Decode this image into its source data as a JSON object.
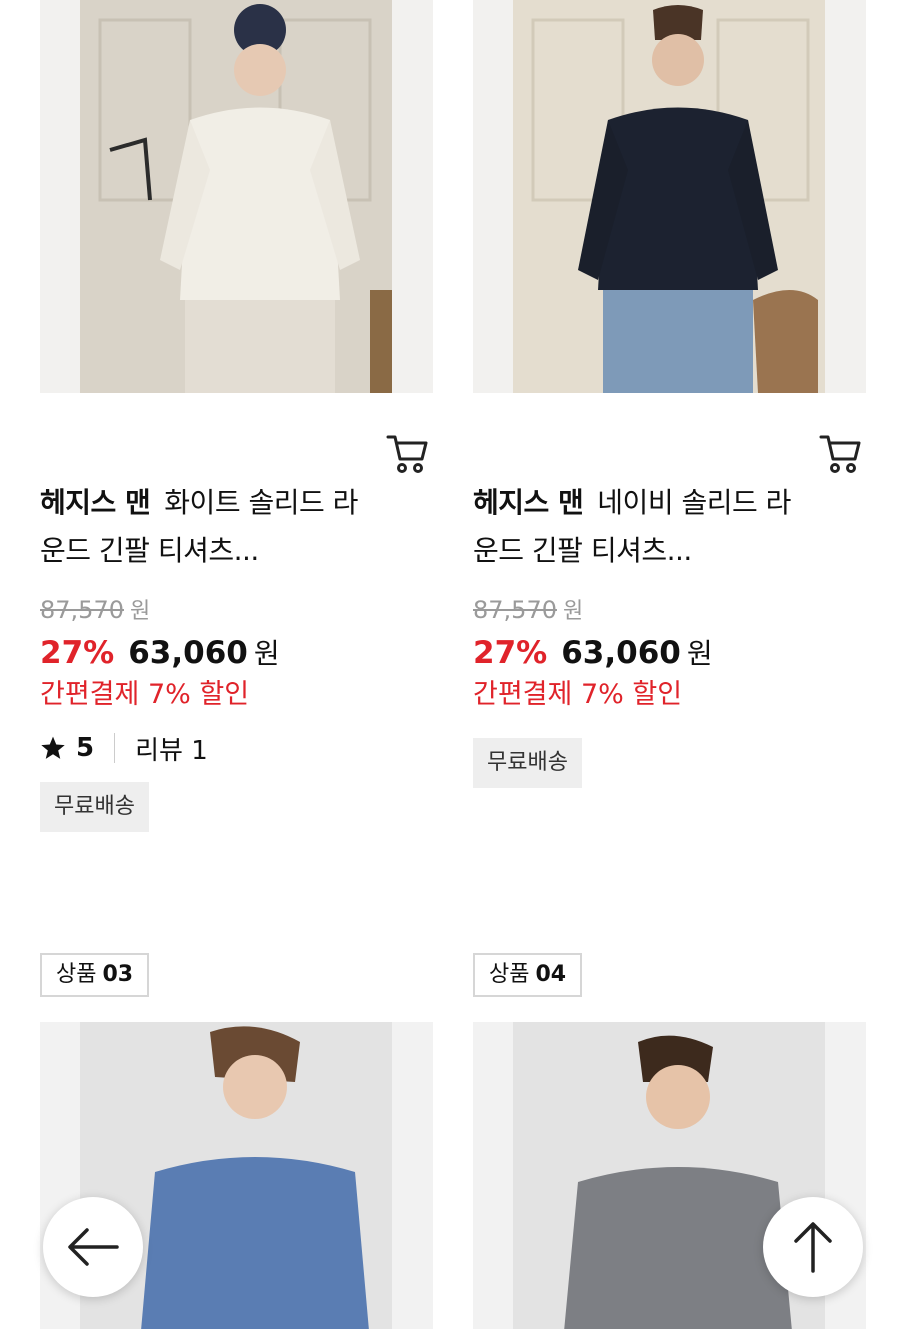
{
  "products": [
    {
      "brand": "헤지스 맨",
      "name_line1": "화이트 솔리드 라",
      "name_line2": "운드 긴팔 티셔츠...",
      "original_price": "87,570",
      "currency": "원",
      "discount_rate": "27%",
      "sale_price": "63,060",
      "pay_discount": "간편결제 7% 할인",
      "rating": "5",
      "review_label": "리뷰 1",
      "shipping_badge": "무료배송",
      "shirt_color": "#f1eee6"
    },
    {
      "brand": "헤지스 맨",
      "name_line1": "네이비 솔리드 라",
      "name_line2": "운드 긴팔 티셔츠...",
      "original_price": "87,570",
      "currency": "원",
      "discount_rate": "27%",
      "sale_price": "63,060",
      "pay_discount": "간편결제 7% 할인",
      "shipping_badge": "무료배송",
      "shirt_color": "#1c2230"
    },
    {
      "label_prefix": "상품",
      "label_number": "03",
      "shirt_color": "#5a7db3"
    },
    {
      "label_prefix": "상품",
      "label_number": "04",
      "shirt_color": "#7d7f84"
    }
  ],
  "icons": {
    "cart": "cart-icon",
    "star": "star-icon",
    "back": "arrow-left-icon",
    "top": "arrow-up-icon"
  },
  "colors": {
    "accent": "#e0232a",
    "badge_bg": "#eeeeee"
  }
}
